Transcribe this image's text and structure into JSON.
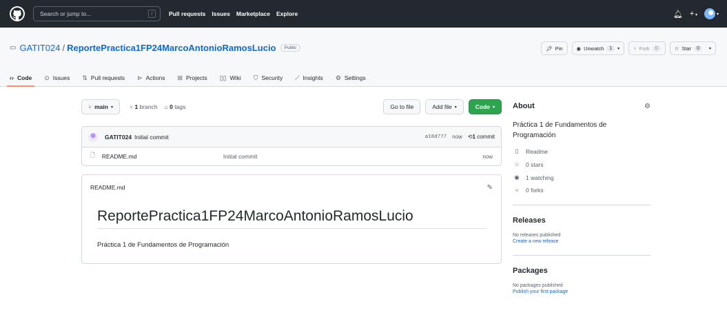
{
  "topbar": {
    "search_placeholder": "Search or jump to...",
    "slash_hint": "/",
    "nav": [
      "Pull requests",
      "Issues",
      "Marketplace",
      "Explore"
    ]
  },
  "repo": {
    "owner": "GATIT024",
    "separator": "/",
    "name": "ReportePractica1FP24MarcoAntonioRamosLucio",
    "visibility": "Public",
    "pin_label": "Pin",
    "unwatch_label": "Unwatch",
    "watch_count": "1",
    "fork_label": "Fork",
    "fork_count": "0",
    "star_label": "Star",
    "star_count": "0"
  },
  "tabs": [
    {
      "label": "Code",
      "icon": "code-icon"
    },
    {
      "label": "Issues",
      "icon": "issue-icon"
    },
    {
      "label": "Pull requests",
      "icon": "pull-request-icon"
    },
    {
      "label": "Actions",
      "icon": "play-icon"
    },
    {
      "label": "Projects",
      "icon": "table-icon"
    },
    {
      "label": "Wiki",
      "icon": "book-icon"
    },
    {
      "label": "Security",
      "icon": "shield-icon"
    },
    {
      "label": "Insights",
      "icon": "graph-icon"
    },
    {
      "label": "Settings",
      "icon": "gear-icon"
    }
  ],
  "filebar": {
    "branch": "main",
    "branches_count": "1",
    "branches_label": "branch",
    "tags_count": "0",
    "tags_label": "tags",
    "goto_file": "Go to file",
    "add_file": "Add file",
    "code": "Code"
  },
  "commit": {
    "author": "GATIT024",
    "message": "Initial commit",
    "sha": "a18d777",
    "time": "now",
    "count": "1",
    "count_label": "commit"
  },
  "files": [
    {
      "name": "README.md",
      "message": "Initial commit",
      "time": "now"
    }
  ],
  "readme": {
    "filename": "README.md",
    "title": "ReportePractica1FP24MarcoAntonioRamosLucio",
    "body": "Práctica 1 de Fundamentos de Programación"
  },
  "about": {
    "heading": "About",
    "description": "Práctica 1 de Fundamentos de Programación",
    "readme_label": "Readme",
    "stars": "0 stars",
    "watching": "1 watching",
    "forks": "0 forks"
  },
  "releases": {
    "heading": "Releases",
    "empty": "No releases published",
    "link": "Create a new release"
  },
  "packages": {
    "heading": "Packages",
    "empty": "No packages published",
    "link": "Publish your first package"
  },
  "colors": {
    "header_bg": "#24292f",
    "link": "#0969da",
    "primary_green": "#2da44e",
    "active_tab_underline": "#fd8c73"
  }
}
